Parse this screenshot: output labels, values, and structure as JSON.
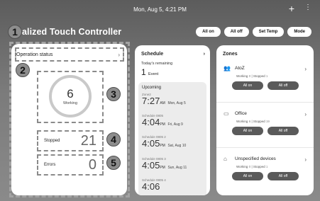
{
  "topbar": {
    "datetime": "Mon, Aug 5, 4:21 PM",
    "plus": "+",
    "more": "⋮"
  },
  "app": {
    "title": "ntralized Touch Controller"
  },
  "top_buttons": {
    "all_on": "All on",
    "all_off": "All off",
    "set_temp": "Set Temp",
    "mode": "Mode"
  },
  "callouts": [
    "1",
    "2",
    "3",
    "4",
    "5"
  ],
  "status": {
    "heading": "Operation status",
    "chevron": "›",
    "working_count": "6",
    "working_label": "Working",
    "stopped_label": "Stopped",
    "stopped_count": "21",
    "errors_label": "Errors",
    "errors_count": "0"
  },
  "schedule": {
    "heading": "Schedule",
    "chevron": "›",
    "today_label": "Today's remaining",
    "today_count": "1",
    "today_unit": "Event",
    "upcoming_label": "Upcoming",
    "items": [
      {
        "name": "Zone2",
        "time": "7:27",
        "ampm": "AM",
        "date": "Mon, Aug 5"
      },
      {
        "name": "Schedule 0805",
        "time": "4:04",
        "ampm": "PM",
        "date": "Fri, Aug 9"
      },
      {
        "name": "Schedule 0805 2",
        "time": "4:05",
        "ampm": "PM",
        "date": "Sat, Aug 10"
      },
      {
        "name": "Schedule 0805 3",
        "time": "4:05",
        "ampm": "PM",
        "date": "Sun, Aug 11"
      },
      {
        "name": "Schedule 0805 4",
        "time": "4:06",
        "ampm": "",
        "date": ""
      }
    ]
  },
  "zones": {
    "heading": "Zones",
    "working_label": "Working",
    "stopped_label": "Stopped",
    "all_on": "All on",
    "all_off": "All off",
    "items": [
      {
        "name": "AtoZ",
        "icon": "group-icon",
        "working": "0",
        "stopped": "1"
      },
      {
        "name": "Office",
        "icon": "office-icon",
        "working": "6",
        "stopped": "19"
      },
      {
        "name": "Unspecified devices",
        "icon": "house-icon",
        "working": "0",
        "stopped": "1"
      }
    ]
  }
}
